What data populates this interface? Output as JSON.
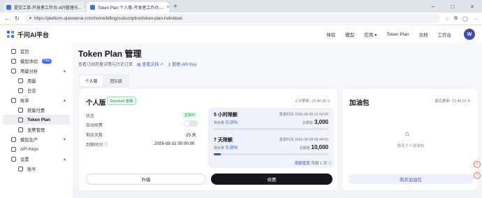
{
  "browser": {
    "tabs": [
      {
        "label": "提交工单-开发者工作台-API管理与..."
      },
      {
        "label": "Token Plan 个人版-开发者工作台-...",
        "active": true
      }
    ],
    "url": "https://platform.qianwenai.com/home/billing/subscription/token-plan-individual"
  },
  "header": {
    "brand": "千问AI平台",
    "nav": [
      "体验",
      "模型",
      "应用",
      "Token Plan",
      "文档",
      "工作台"
    ],
    "nav_app_chevron": "▾",
    "avatar_letter": "W"
  },
  "sidebar": {
    "items": [
      {
        "label": "首页",
        "level": 0
      },
      {
        "label": "模型体验",
        "level": 0,
        "badge": "Hot"
      },
      {
        "label": "用量分析",
        "level": 0,
        "expand": "▴"
      },
      {
        "label": "用量",
        "level": 1
      },
      {
        "label": "日志",
        "level": 1
      },
      {
        "label": "账单",
        "level": 0,
        "expand": "▴"
      },
      {
        "label": "按量付费",
        "level": 1
      },
      {
        "label": "Token Plan",
        "level": 1,
        "active": true
      },
      {
        "label": "发票管理",
        "level": 1
      },
      {
        "label": "模型生产",
        "level": 0,
        "expand": "▾"
      },
      {
        "label": "API Keys",
        "level": 0
      },
      {
        "label": "设置",
        "level": 0,
        "expand": "▴"
      },
      {
        "label": "账号",
        "level": 1
      }
    ]
  },
  "main": {
    "title": "Token Plan 管理",
    "subtitle": "查看订阅用量详情与历史订单",
    "link_docs": "查看文档 ↗",
    "link_api": "管理 API Key",
    "tabs": [
      "个人版",
      "团队版"
    ],
    "personal": {
      "title": "个人版",
      "badge": "Standard 套餐",
      "updated": "上次更新: 21:46:30 ↻",
      "status_label": "状态",
      "status_value": "生效中",
      "auto_renew_label": "自动续费",
      "auto_renew_on": false,
      "days_left_label": "剩余天数",
      "days_left_value": "25 天",
      "expire_label": "到期时间 ⓘ",
      "expire_value": "2026-08-31 00:00:00",
      "limit5h": {
        "title": "5 小时限额",
        "reset": "重置时间 2026-08-06 01:59:00",
        "used_label": "剩余量",
        "used_value": "0.0%",
        "used_fraction": 0.0,
        "total_label": "总额度",
        "total_value": "3,000"
      },
      "limit7d": {
        "title": "7 天限额",
        "reset": "重置时间 2026-08-08 09:44:00",
        "used_label": "剩余量",
        "used_value": "5.8%",
        "used_fraction": 0.058,
        "total_label": "总额度",
        "total_value": "10,000"
      },
      "reset_link": "限额重置",
      "reset_count": "可用 1 次 ⓘ",
      "upgrade_label": "升级",
      "renew_label": "续费"
    },
    "addon": {
      "title": "加油包",
      "updated": "最后更新: 21:46:31 ↻",
      "empty": "暂无个人加油包",
      "buy_label": "购买加油包"
    }
  },
  "colors": {
    "accent": "#3b5bdb",
    "primary_btn": "#15171c",
    "success": "#1a9c52"
  }
}
